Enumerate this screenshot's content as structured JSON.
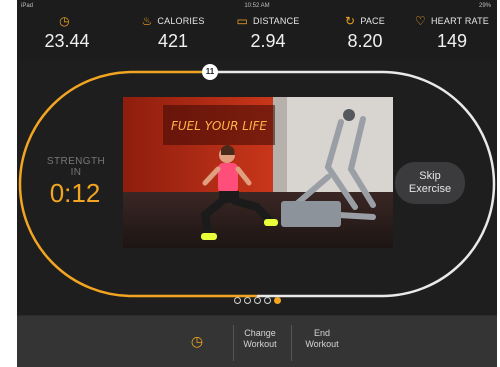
{
  "statusbar": {
    "left": "iPad",
    "time": "10:52 AM",
    "battery": "29%"
  },
  "metrics": [
    {
      "icon": "clock-icon",
      "glyph": "◷",
      "label": "",
      "value": "23.44"
    },
    {
      "icon": "flame-icon",
      "glyph": "♨",
      "label": "CALORIES",
      "value": "421"
    },
    {
      "icon": "ruler-icon",
      "glyph": "▭",
      "label": "DISTANCE",
      "value": "2.94"
    },
    {
      "icon": "speedometer-icon",
      "glyph": "↻",
      "label": "PACE",
      "value": "8.20"
    },
    {
      "icon": "heart-icon",
      "glyph": "♡",
      "label": "HEART RATE",
      "value": "149"
    }
  ],
  "track": {
    "lap": "11",
    "progress_color": "#f2a521",
    "remaining_color": "#e9e9e9"
  },
  "strength": {
    "label_line1": "STRENGTH",
    "label_line2": "IN",
    "time": "0:12"
  },
  "video": {
    "banner_text": "FUEL YOUR LIFE"
  },
  "skip": {
    "line1": "Skip",
    "line2": "Exercise"
  },
  "pager": {
    "count": 5,
    "active_index": 4
  },
  "bottom": {
    "change_line1": "Change",
    "change_line2": "Workout",
    "end_line1": "End",
    "end_line2": "Workout"
  },
  "colors": {
    "accent": "#f2a521",
    "background": "#1c1c1d",
    "bar": "#343435"
  }
}
